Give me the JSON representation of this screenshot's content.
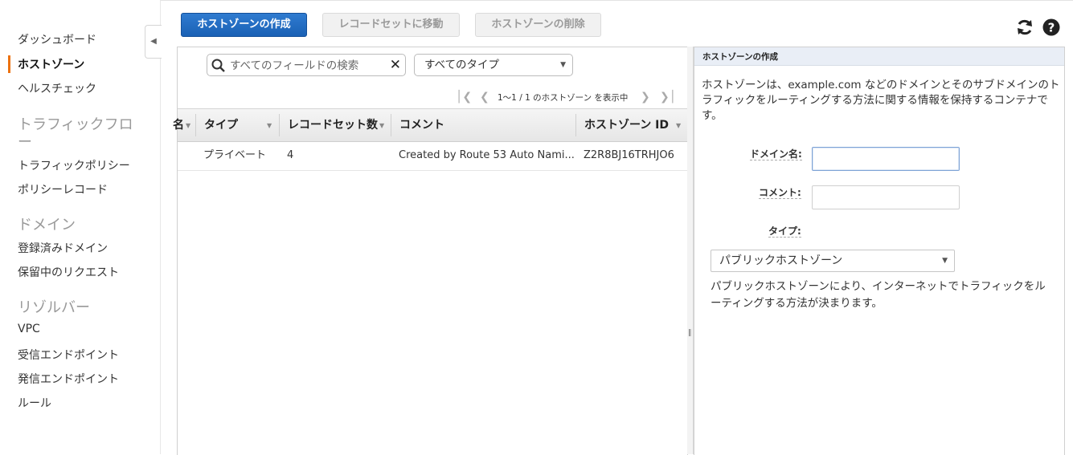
{
  "sidebar": {
    "items": {
      "dashboard": "ダッシュボード",
      "hosted_zones": "ホストゾーン",
      "health_checks": "ヘルスチェック",
      "traffic_policies": "トラフィックポリシー",
      "policy_records": "ポリシーレコード",
      "registered_domains": "登録済みドメイン",
      "pending_requests": "保留中のリクエスト",
      "vpc": "VPC",
      "inbound_endpoints": "受信エンドポイント",
      "outbound_endpoints": "発信エンドポイント",
      "rules": "ルール"
    },
    "sections": {
      "traffic_flow_1": "トラフィックフロ",
      "traffic_flow_2": "ー",
      "domains": "ドメイン",
      "resolver": "リゾルバー"
    },
    "active_item": "hosted_zones",
    "accent_color": "#ec7211"
  },
  "toolbar": {
    "create_label": "ホストゾーンの作成",
    "goto_label": "レコードセットに移動",
    "delete_label": "ホストゾーンの削除",
    "refresh_icon": "refresh-icon",
    "help_icon": "help-icon",
    "primary_color": "#1a61b5"
  },
  "search": {
    "placeholder": "すべてのフィールドの検索",
    "value": "",
    "type_filter": "すべてのタイプ"
  },
  "pager": {
    "text": "1～1 / 1 のホストゾーン を表示中"
  },
  "table": {
    "columns": {
      "partial": "名",
      "type": "タイプ",
      "record_count": "レコードセット数",
      "comment": "コメント",
      "zone_id": "ホストゾーン ID"
    },
    "rows": [
      {
        "type": "プライベート",
        "record_count": "4",
        "comment": "Created by Route 53 Auto Nami...",
        "zone_id": "Z2R8BJ16TRHJO6"
      }
    ]
  },
  "create_panel": {
    "header": "ホストゾーンの作成",
    "description": "ホストゾーンは、example.com などのドメインとそのサブドメインのトラフィックをルーティングする方法に関する情報を保持するコンテナです。",
    "domain_label": "ドメイン名:",
    "domain_value": "",
    "comment_label": "コメント:",
    "comment_value": "",
    "type_label": "タイプ:",
    "type_value": "パブリックホストゾーン",
    "type_help": "パブリックホストゾーンにより、インターネットでトラフィックをルーティングする方法が決まります。"
  }
}
